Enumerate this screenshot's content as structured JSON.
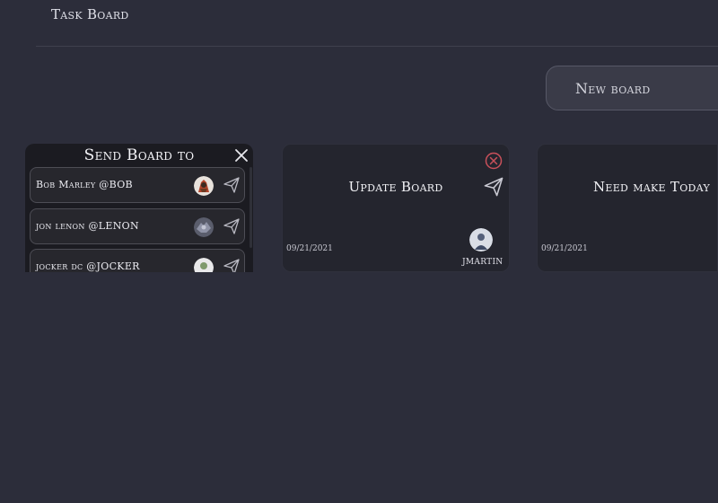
{
  "header": {
    "title": "Task Board"
  },
  "toolbar": {
    "new_board_label": "New board"
  },
  "send_panel": {
    "title": "Send Board to",
    "recipients": [
      {
        "name": "Bob Marley @BOB",
        "avatar": "avatar-bob"
      },
      {
        "name": "jon lenon @LENON",
        "avatar": "avatar-lenon"
      },
      {
        "name": "jocker dc @JOCKER",
        "avatar": "avatar-jocker"
      }
    ]
  },
  "boards": [
    {
      "title": "Update Board",
      "date": "09/21/2021",
      "user": "JMARTIN"
    },
    {
      "title": "Need make Today",
      "date": "09/21/2021"
    }
  ],
  "colors": {
    "background": "#2c2d3a",
    "card": "#24252e",
    "delete_accent": "#c8505a"
  }
}
